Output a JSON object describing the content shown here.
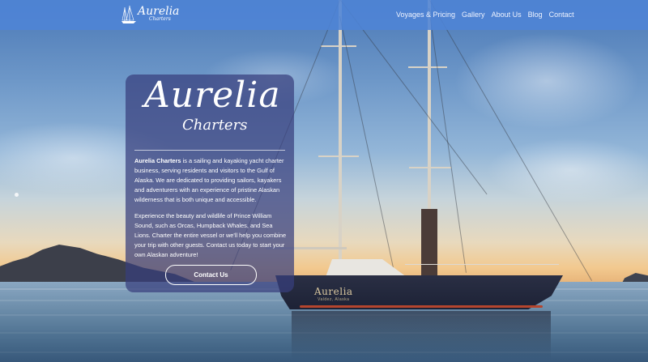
{
  "header": {
    "logo_text": "Aurelia",
    "logo_sub": "Charters",
    "nav": [
      {
        "label": "Voyages & Pricing"
      },
      {
        "label": "Gallery"
      },
      {
        "label": "About Us"
      },
      {
        "label": "Blog"
      },
      {
        "label": "Contact"
      }
    ]
  },
  "hero": {
    "brand_title": "Aurelia",
    "brand_sub": "Charters",
    "para1_bold": "Aurelia Charters",
    "para1_rest": " is a sailing and kayaking yacht charter business, serving residents and visitors to the Gulf of Alaska. We are dedicated to providing sailors, kayakers and adventurers with an experience of pristine Alaskan wilderness that is both unique and accessible.",
    "para2": "Experience the beauty and wildlife of Prince William Sound, such as Orcas, Humpback Whales, and Sea Lions. Charter the entire vessel or we'll help you combine your trip with other guests. Contact us today to start your own Alaskan adventure!",
    "cta_label": "Contact Us"
  },
  "yacht": {
    "name": "Aurelia",
    "subtitle": "Valdez, Alaska"
  }
}
